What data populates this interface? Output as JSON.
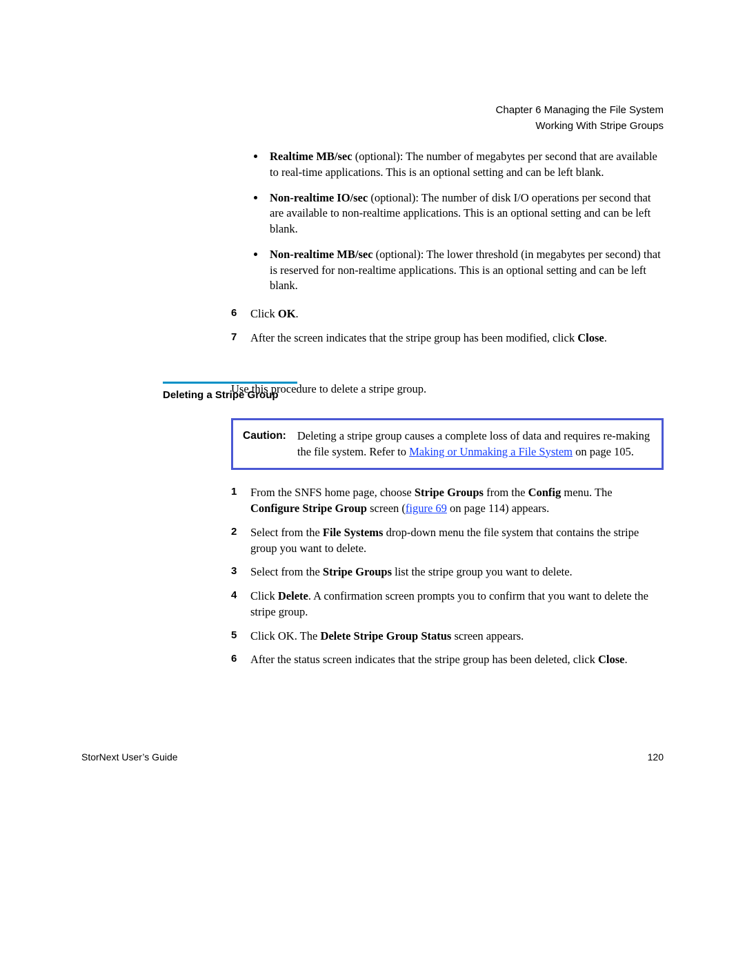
{
  "header": {
    "line1": "Chapter 6  Managing the File System",
    "line2": "Working With Stripe Groups"
  },
  "bullets": [
    {
      "term": "Realtime MB/sec",
      "suffix": " (optional): The number of megabytes per second that are available to real-time applications. This is an optional setting and can be left blank."
    },
    {
      "term": "Non-realtime IO/sec",
      "suffix": " (optional): The number of disk I/O operations per second that are available to non-realtime applications. This is an optional setting and can be left blank."
    },
    {
      "term": "Non-realtime MB/sec",
      "suffix": " (optional): The lower threshold (in megabytes per second) that is reserved for non-realtime applications. This is an optional setting and can be left blank."
    }
  ],
  "steps_top": [
    {
      "pre": "Click ",
      "bold": "OK",
      "post": "."
    },
    {
      "pre": "After the screen indicates that the stripe group has been modified, click ",
      "bold": "Close",
      "post": "."
    }
  ],
  "sidebar_label": "Deleting a Stripe Group",
  "intro": "Use this procedure to delete a stripe group.",
  "caution": {
    "label": "Caution:",
    "text1": "Deleting a stripe group causes a complete loss of data and requires re-making the file system. Refer to ",
    "link": "Making or Unmaking a File System",
    "text2": " on page  105."
  },
  "steps2": [
    {
      "segments": [
        {
          "t": "From the SNFS home page, choose "
        },
        {
          "t": "Stripe Groups",
          "b": true
        },
        {
          "t": " from the "
        },
        {
          "t": "Config",
          "b": true
        },
        {
          "t": " menu. The "
        },
        {
          "t": "Configure Stripe Group",
          "b": true
        },
        {
          "t": " screen ("
        },
        {
          "t": "figure 69",
          "link": true
        },
        {
          "t": " on page  114) appears."
        }
      ]
    },
    {
      "segments": [
        {
          "t": "Select from the "
        },
        {
          "t": "File Systems",
          "b": true
        },
        {
          "t": " drop-down menu the file system that contains the stripe group you want to delete."
        }
      ]
    },
    {
      "segments": [
        {
          "t": "Select from the "
        },
        {
          "t": "Stripe Groups",
          "b": true
        },
        {
          "t": " list the stripe group you want to delete."
        }
      ]
    },
    {
      "segments": [
        {
          "t": "Click "
        },
        {
          "t": "Delete",
          "b": true
        },
        {
          "t": ". A confirmation screen prompts you to confirm that you want to delete the stripe group."
        }
      ]
    },
    {
      "segments": [
        {
          "t": "Click OK. The "
        },
        {
          "t": "Delete Stripe Group Status",
          "b": true
        },
        {
          "t": " screen appears."
        }
      ]
    },
    {
      "segments": [
        {
          "t": "After the status screen indicates that the stripe group has been deleted, click "
        },
        {
          "t": "Close",
          "b": true
        },
        {
          "t": "."
        }
      ]
    }
  ],
  "footer": {
    "left": "StorNext User’s Guide",
    "right": "120"
  }
}
